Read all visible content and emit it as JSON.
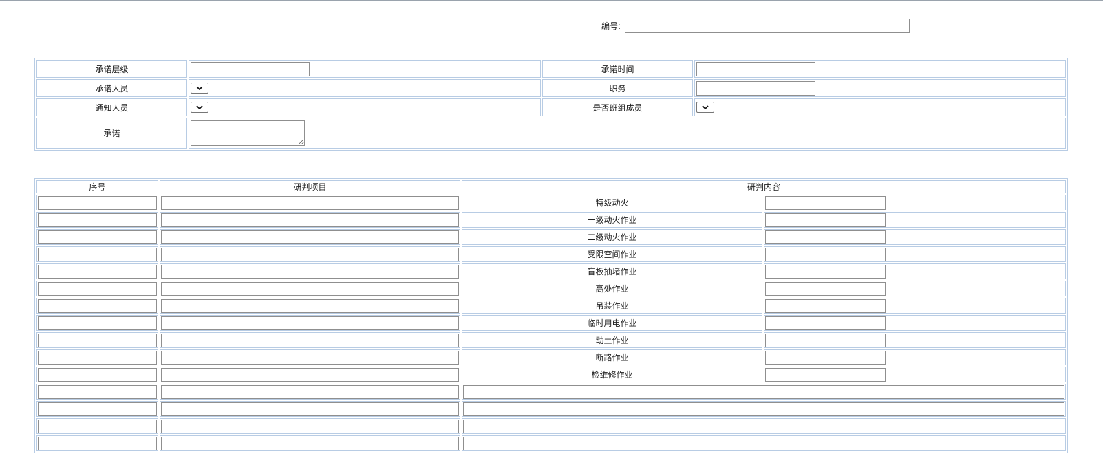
{
  "header": {
    "number_label": "编号:",
    "number_value": ""
  },
  "form": {
    "level_label": "承诺层级",
    "level_value": "",
    "time_label": "承诺时间",
    "time_value": "",
    "person_label": "承诺人员",
    "person_value": "",
    "position_label": "职务",
    "position_value": "",
    "notify_label": "通知人员",
    "notify_value": "",
    "team_member_label": "是否班组成员",
    "team_member_value": "",
    "promise_label": "承诺",
    "promise_value": ""
  },
  "grid": {
    "headers": [
      "序号",
      "研判项目",
      "研判内容"
    ],
    "content_items": [
      "特级动火",
      "一级动火作业",
      "二级动火作业",
      "受限空间作业",
      "盲板抽堵作业",
      "高处作业",
      "吊装作业",
      "临时用电作业",
      "动土作业",
      "断路作业",
      "检维修作业"
    ],
    "extra_rows": 4
  }
}
